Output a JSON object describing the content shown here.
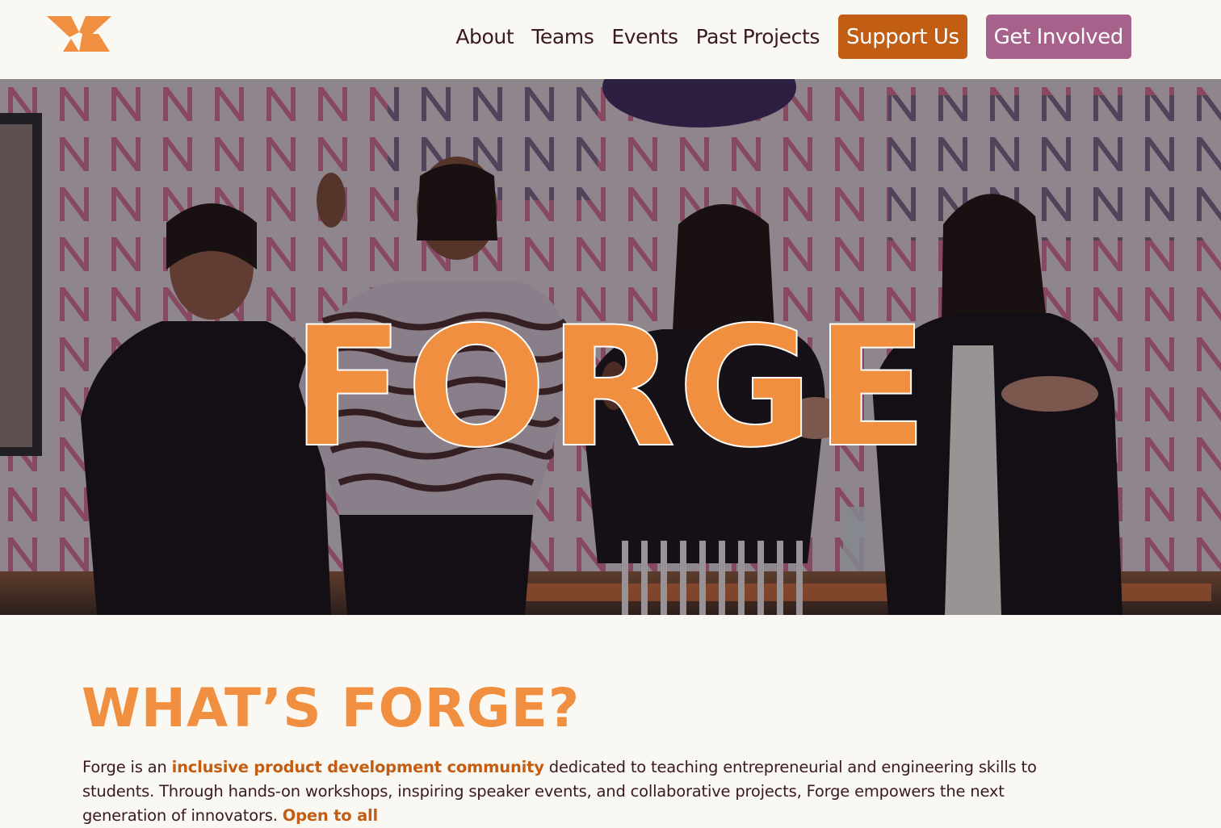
{
  "nav": {
    "logo_icon": "forge-logo-icon",
    "links": [
      "About",
      "Teams",
      "Events",
      "Past Projects"
    ],
    "support_label": "Support Us",
    "involved_label": "Get Involved"
  },
  "hero": {
    "title": "FORGE"
  },
  "about": {
    "heading": "WHAT’S FORGE?",
    "intro_1": "Forge is an ",
    "highlight_1": "inclusive product development community",
    "intro_2": " dedicated to teaching entrepreneurial and engineering skills to students. Through hands-on workshops, inspiring speaker events, and collaborative projects, Forge empowers the next generation of innovators. ",
    "highlight_2": "Open to all"
  },
  "colors": {
    "accent_orange": "#f08f40",
    "support_button": "#c25e14",
    "involved_button": "#a6628a",
    "text_dark": "#3a1a22",
    "background": "#faf8f3"
  }
}
